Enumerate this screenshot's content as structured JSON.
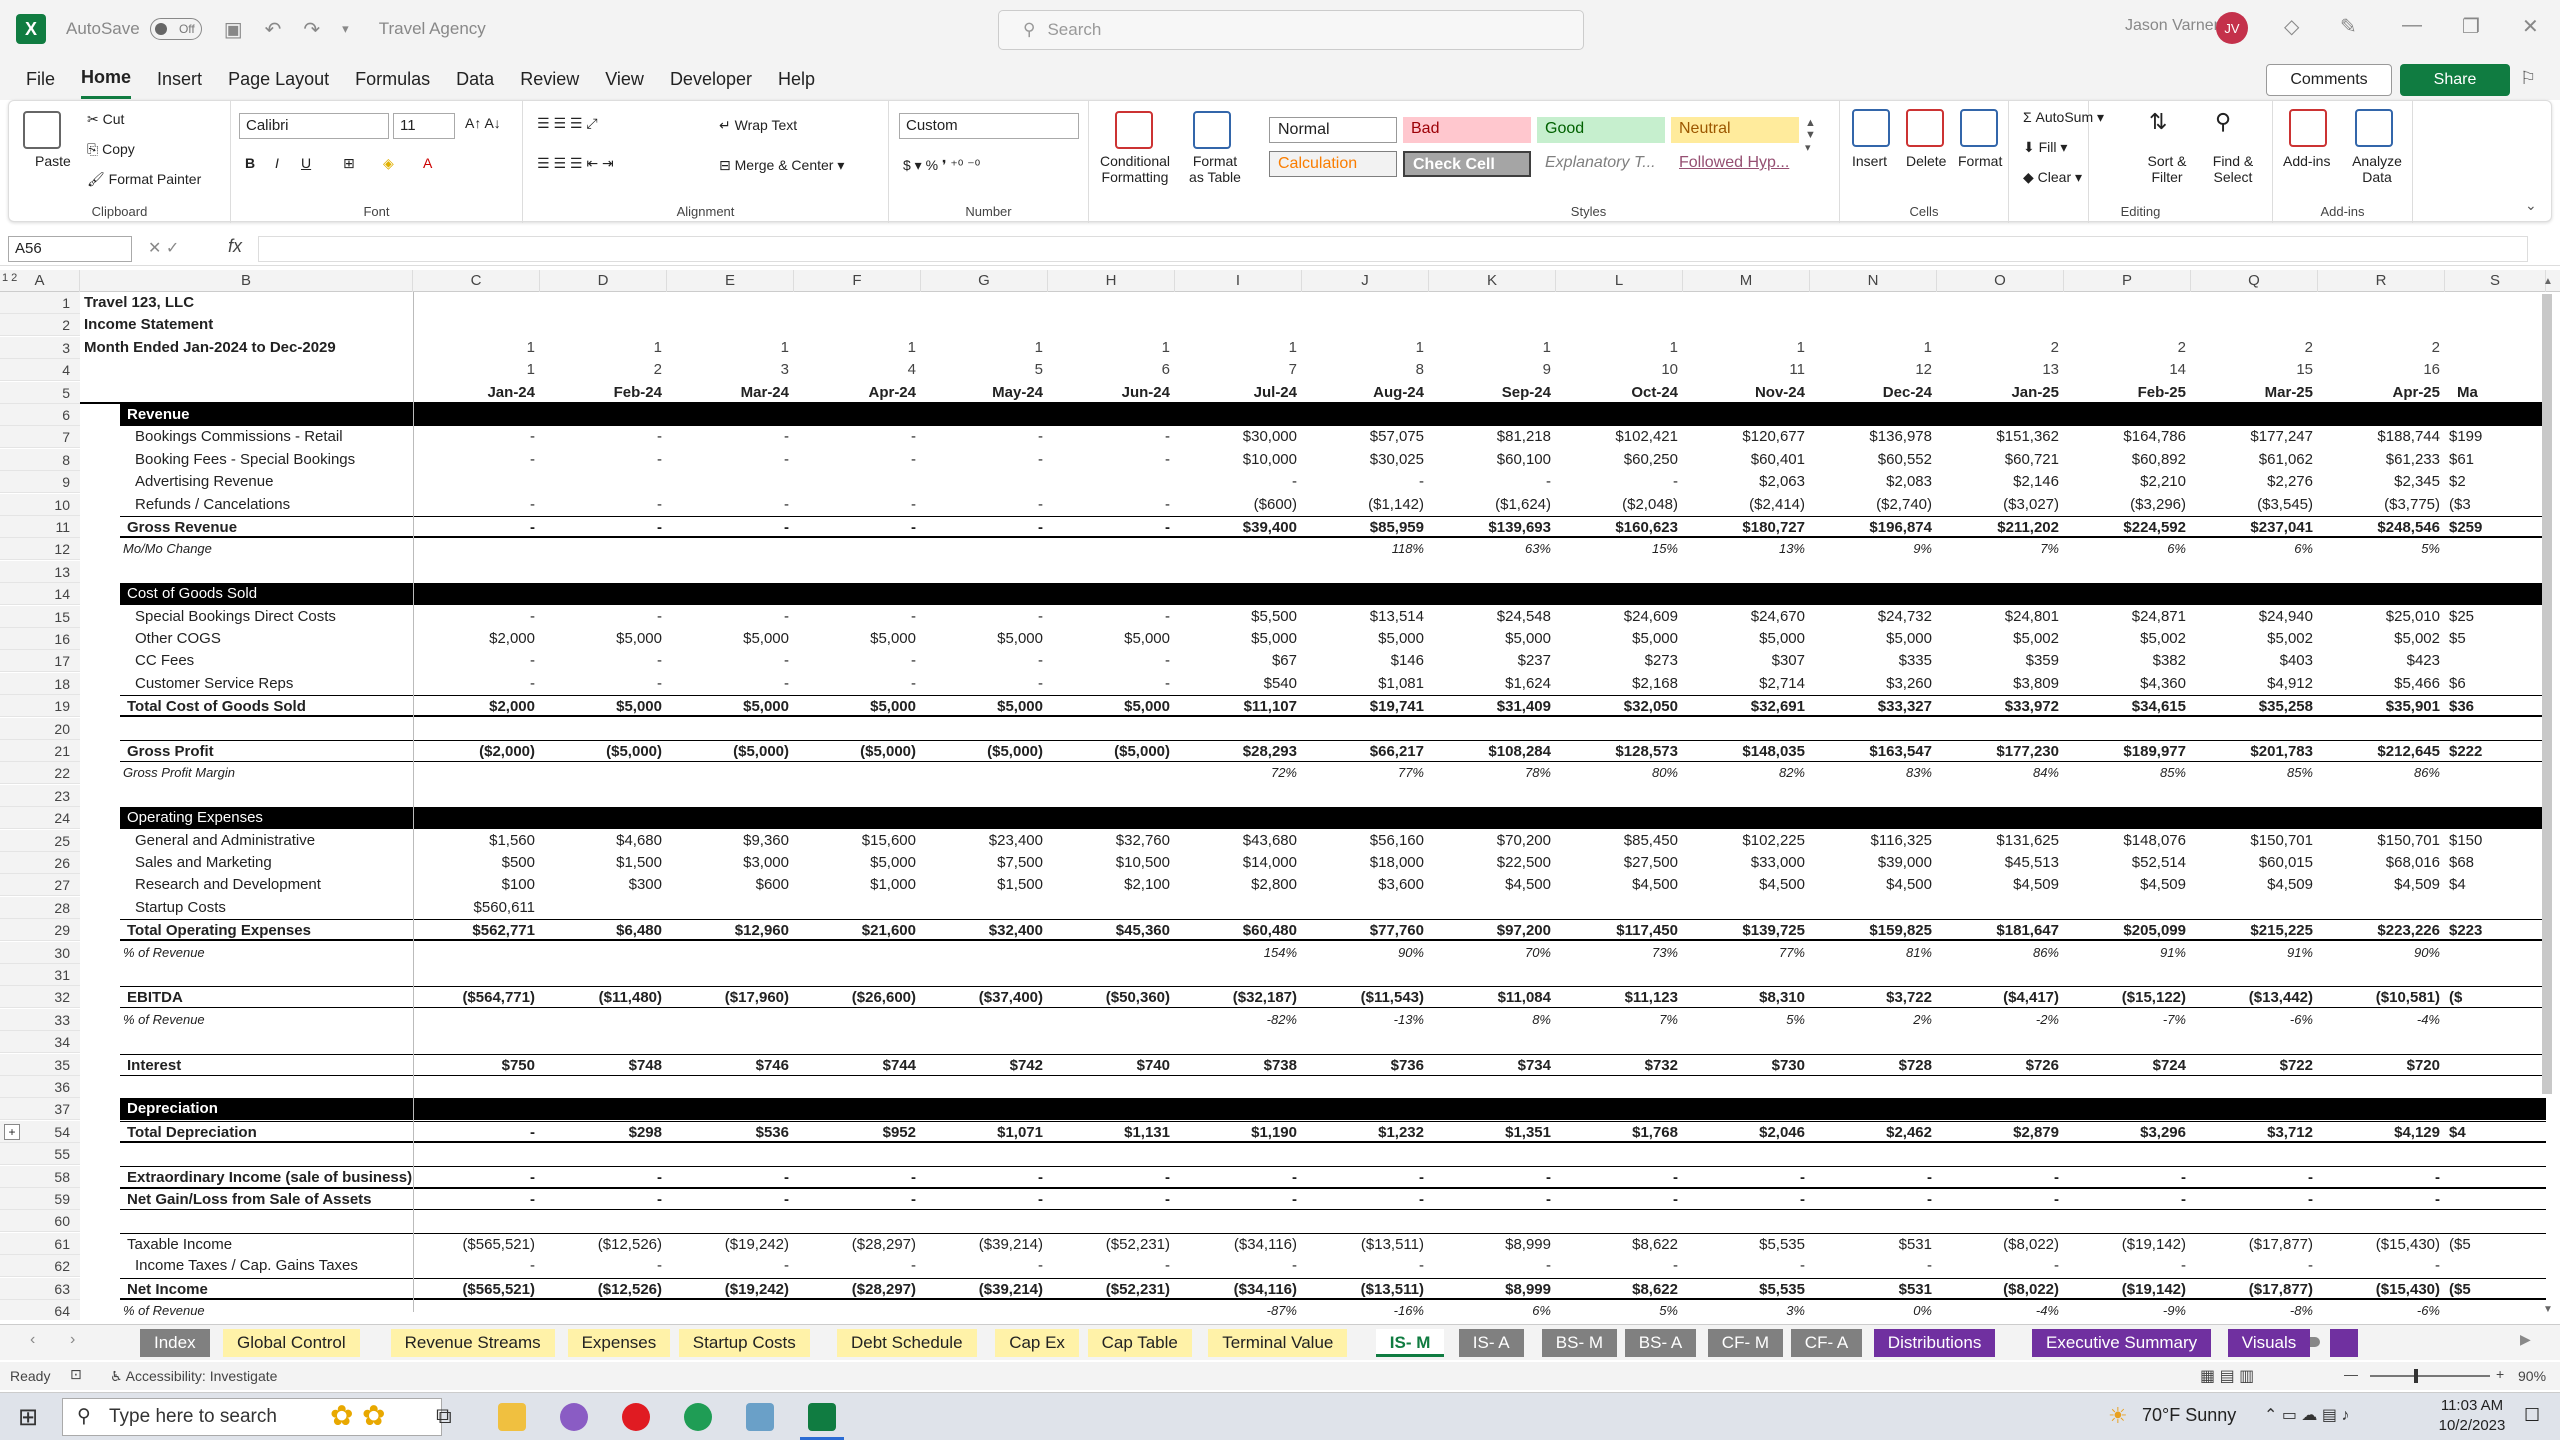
{
  "titlebar": {
    "autosave": "AutoSave",
    "toggle": "Off",
    "title": "Travel Agency",
    "search": "Search",
    "user": "Jason Varner",
    "initials": "JV"
  },
  "menu": [
    "File",
    "Home",
    "Insert",
    "Page Layout",
    "Formulas",
    "Data",
    "Review",
    "View",
    "Developer",
    "Help"
  ],
  "menu_active": "Home",
  "comments": "Comments",
  "share": "Share",
  "ribbon": {
    "clipboard": {
      "label": "Clipboard",
      "paste": "Paste",
      "cut": "Cut",
      "copy": "Copy",
      "format_painter": "Format Painter"
    },
    "font": {
      "label": "Font",
      "name": "Calibri",
      "size": "11"
    },
    "alignment": {
      "label": "Alignment",
      "wrap": "Wrap Text",
      "merge": "Merge & Center"
    },
    "number": {
      "label": "Number",
      "format": "Custom"
    },
    "styles": {
      "label": "Styles",
      "cond": "Conditional Formatting",
      "table": "Format as Table",
      "cells": [
        "Normal",
        "Bad",
        "Good",
        "Neutral",
        "Calculation",
        "Check Cell",
        "Explanatory T...",
        "Followed Hyp..."
      ]
    },
    "cells": {
      "label": "Cells",
      "insert": "Insert",
      "delete": "Delete",
      "format": "Format"
    },
    "editing": {
      "label": "Editing",
      "autosum": "AutoSum",
      "fill": "Fill",
      "clear": "Clear",
      "sort": "Sort & Filter",
      "find": "Find & Select"
    },
    "addins": {
      "label": "Add-ins",
      "addins": "Add-ins",
      "analyze": "Analyze Data"
    }
  },
  "formula": {
    "namebox": "A56",
    "fx": "fx"
  },
  "columns": [
    "A",
    "B",
    "C",
    "D",
    "E",
    "F",
    "G",
    "H",
    "I",
    "J",
    "K",
    "L",
    "M",
    "N",
    "O",
    "P",
    "Q",
    "R",
    "S"
  ],
  "header_rows": {
    "r1": "Travel 123, LLC",
    "r2": "Income Statement",
    "r3": "Month Ended Jan-2024 to Dec-2029",
    "years": [
      "1",
      "1",
      "1",
      "1",
      "1",
      "1",
      "1",
      "1",
      "1",
      "1",
      "1",
      "1",
      "2",
      "2",
      "2",
      "2"
    ],
    "months": [
      "1",
      "2",
      "3",
      "4",
      "5",
      "6",
      "7",
      "8",
      "9",
      "10",
      "11",
      "12",
      "13",
      "14",
      "15",
      "16"
    ],
    "dates": [
      "Jan-24",
      "Feb-24",
      "Mar-24",
      "Apr-24",
      "May-24",
      "Jun-24",
      "Jul-24",
      "Aug-24",
      "Sep-24",
      "Oct-24",
      "Nov-24",
      "Dec-24",
      "Jan-25",
      "Feb-25",
      "Mar-25",
      "Apr-25"
    ],
    "cut_date": "Ma"
  },
  "rows": [
    {
      "n": "1"
    },
    {
      "n": "2"
    },
    {
      "n": "3"
    },
    {
      "n": "4"
    },
    {
      "n": "5"
    },
    {
      "n": "6",
      "label": "Revenue",
      "style": "black"
    },
    {
      "n": "7",
      "label": "Bookings Commissions - Retail",
      "in": true,
      "v": [
        "-",
        "-",
        "-",
        "-",
        "-",
        "-",
        "$30,000",
        "$57,075",
        "$81,218",
        "$102,421",
        "$120,677",
        "$136,978",
        "$151,362",
        "$164,786",
        "$177,247",
        "$188,744"
      ],
      "cut": "$199"
    },
    {
      "n": "8",
      "label": "Booking Fees - Special Bookings",
      "in": true,
      "v": [
        "-",
        "-",
        "-",
        "-",
        "-",
        "-",
        "$10,000",
        "$30,025",
        "$60,100",
        "$60,250",
        "$60,401",
        "$60,552",
        "$60,721",
        "$60,892",
        "$61,062",
        "$61,233"
      ],
      "cut": "$61"
    },
    {
      "n": "9",
      "label": "Advertising Revenue",
      "in": true,
      "v": [
        "",
        "",
        "",
        "",
        "",
        "",
        "-",
        "-",
        "-",
        "-",
        "$2,063",
        "$2,083",
        "$2,146",
        "$2,210",
        "$2,276",
        "$2,345"
      ],
      "cut": "$2"
    },
    {
      "n": "10",
      "label": "Refunds / Cancelations",
      "in": true,
      "v": [
        "-",
        "-",
        "-",
        "-",
        "-",
        "-",
        "($600)",
        "($1,142)",
        "($1,624)",
        "($2,048)",
        "($2,414)",
        "($2,740)",
        "($3,027)",
        "($3,296)",
        "($3,545)",
        "($3,775)"
      ],
      "cut": "($3"
    },
    {
      "n": "11",
      "label": "Gross Revenue",
      "style": "total",
      "v": [
        "-",
        "-",
        "-",
        "-",
        "-",
        "-",
        "$39,400",
        "$85,959",
        "$139,693",
        "$160,623",
        "$180,727",
        "$196,874",
        "$211,202",
        "$224,592",
        "$237,041",
        "$248,546"
      ],
      "cut": "$259"
    },
    {
      "n": "12",
      "label": "Mo/Mo Change",
      "style": "pct",
      "v": [
        "",
        "",
        "",
        "",
        "",
        "",
        "",
        "118%",
        "63%",
        "15%",
        "13%",
        "9%",
        "7%",
        "6%",
        "6%",
        "5%"
      ]
    },
    {
      "n": "13"
    },
    {
      "n": "14",
      "label": "Cost of Goods Sold",
      "style": "blackn"
    },
    {
      "n": "15",
      "label": "Special Bookings Direct Costs",
      "in": true,
      "v": [
        "-",
        "-",
        "-",
        "-",
        "-",
        "-",
        "$5,500",
        "$13,514",
        "$24,548",
        "$24,609",
        "$24,670",
        "$24,732",
        "$24,801",
        "$24,871",
        "$24,940",
        "$25,010"
      ],
      "cut": "$25"
    },
    {
      "n": "16",
      "label": "Other COGS",
      "in": true,
      "v": [
        "$2,000",
        "$5,000",
        "$5,000",
        "$5,000",
        "$5,000",
        "$5,000",
        "$5,000",
        "$5,000",
        "$5,000",
        "$5,000",
        "$5,000",
        "$5,000",
        "$5,002",
        "$5,002",
        "$5,002",
        "$5,002"
      ],
      "cut": "$5"
    },
    {
      "n": "17",
      "label": "CC Fees",
      "in": true,
      "v": [
        "-",
        "-",
        "-",
        "-",
        "-",
        "-",
        "$67",
        "$146",
        "$237",
        "$273",
        "$307",
        "$335",
        "$359",
        "$382",
        "$403",
        "$423"
      ]
    },
    {
      "n": "18",
      "label": "Customer Service Reps",
      "in": true,
      "v": [
        "-",
        "-",
        "-",
        "-",
        "-",
        "-",
        "$540",
        "$1,081",
        "$1,624",
        "$2,168",
        "$2,714",
        "$3,260",
        "$3,809",
        "$4,360",
        "$4,912",
        "$5,466"
      ],
      "cut": "$6"
    },
    {
      "n": "19",
      "label": "Total Cost of Goods Sold",
      "style": "total",
      "v": [
        "$2,000",
        "$5,000",
        "$5,000",
        "$5,000",
        "$5,000",
        "$5,000",
        "$11,107",
        "$19,741",
        "$31,409",
        "$32,050",
        "$32,691",
        "$33,327",
        "$33,972",
        "$34,615",
        "$35,258",
        "$35,901"
      ],
      "cut": "$36"
    },
    {
      "n": "20"
    },
    {
      "n": "21",
      "label": "Gross Profit",
      "style": "boxed",
      "v": [
        "($2,000)",
        "($5,000)",
        "($5,000)",
        "($5,000)",
        "($5,000)",
        "($5,000)",
        "$28,293",
        "$66,217",
        "$108,284",
        "$128,573",
        "$148,035",
        "$163,547",
        "$177,230",
        "$189,977",
        "$201,783",
        "$212,645"
      ],
      "cut": "$222"
    },
    {
      "n": "22",
      "label": "Gross Profit Margin",
      "style": "pct",
      "v": [
        "",
        "",
        "",
        "",
        "",
        "",
        "72%",
        "77%",
        "78%",
        "80%",
        "82%",
        "83%",
        "84%",
        "85%",
        "85%",
        "86%"
      ]
    },
    {
      "n": "23"
    },
    {
      "n": "24",
      "label": "Operating Expenses",
      "style": "blackn"
    },
    {
      "n": "25",
      "label": "General and Administrative",
      "in": true,
      "v": [
        "$1,560",
        "$4,680",
        "$9,360",
        "$15,600",
        "$23,400",
        "$32,760",
        "$43,680",
        "$56,160",
        "$70,200",
        "$85,450",
        "$102,225",
        "$116,325",
        "$131,625",
        "$148,076",
        "$150,701",
        "$150,701"
      ],
      "cut": "$150"
    },
    {
      "n": "26",
      "label": "Sales and Marketing",
      "in": true,
      "v": [
        "$500",
        "$1,500",
        "$3,000",
        "$5,000",
        "$7,500",
        "$10,500",
        "$14,000",
        "$18,000",
        "$22,500",
        "$27,500",
        "$33,000",
        "$39,000",
        "$45,513",
        "$52,514",
        "$60,015",
        "$68,016"
      ],
      "cut": "$68"
    },
    {
      "n": "27",
      "label": "Research and Development",
      "in": true,
      "v": [
        "$100",
        "$300",
        "$600",
        "$1,000",
        "$1,500",
        "$2,100",
        "$2,800",
        "$3,600",
        "$4,500",
        "$4,500",
        "$4,500",
        "$4,500",
        "$4,509",
        "$4,509",
        "$4,509",
        "$4,509"
      ],
      "cut": "$4"
    },
    {
      "n": "28",
      "label": "Startup Costs",
      "in": true,
      "v": [
        "$560,611",
        "",
        "",
        "",
        "",
        "",
        "",
        "",
        "",
        "",
        "",
        "",
        "",
        "",
        "",
        ""
      ]
    },
    {
      "n": "29",
      "label": "Total Operating Expenses",
      "style": "total",
      "v": [
        "$562,771",
        "$6,480",
        "$12,960",
        "$21,600",
        "$32,400",
        "$45,360",
        "$60,480",
        "$77,760",
        "$97,200",
        "$117,450",
        "$139,725",
        "$159,825",
        "$181,647",
        "$205,099",
        "$215,225",
        "$223,226"
      ],
      "cut": "$223"
    },
    {
      "n": "30",
      "label": "% of Revenue",
      "style": "pct",
      "v": [
        "",
        "",
        "",
        "",
        "",
        "",
        "154%",
        "90%",
        "70%",
        "73%",
        "77%",
        "81%",
        "86%",
        "91%",
        "91%",
        "90%"
      ]
    },
    {
      "n": "31"
    },
    {
      "n": "32",
      "label": "EBITDA",
      "style": "boxed",
      "v": [
        "($564,771)",
        "($11,480)",
        "($17,960)",
        "($26,600)",
        "($37,400)",
        "($50,360)",
        "($32,187)",
        "($11,543)",
        "$11,084",
        "$11,123",
        "$8,310",
        "$3,722",
        "($4,417)",
        "($15,122)",
        "($13,442)",
        "($10,581)"
      ],
      "cut": "($"
    },
    {
      "n": "33",
      "label": "% of Revenue",
      "style": "pct",
      "v": [
        "",
        "",
        "",
        "",
        "",
        "",
        "-82%",
        "-13%",
        "8%",
        "7%",
        "5%",
        "2%",
        "-2%",
        "-7%",
        "-6%",
        "-4%"
      ]
    },
    {
      "n": "34"
    },
    {
      "n": "35",
      "label": "Interest",
      "style": "boxed",
      "v": [
        "$750",
        "$748",
        "$746",
        "$744",
        "$742",
        "$740",
        "$738",
        "$736",
        "$734",
        "$732",
        "$730",
        "$728",
        "$726",
        "$724",
        "$722",
        "$720"
      ]
    },
    {
      "n": "36"
    },
    {
      "n": "37",
      "label": "Depreciation",
      "style": "black"
    },
    {
      "n": "54",
      "label": "Total Depreciation",
      "style": "totalb",
      "v": [
        "-",
        "$298",
        "$536",
        "$952",
        "$1,071",
        "$1,131",
        "$1,190",
        "$1,232",
        "$1,351",
        "$1,768",
        "$2,046",
        "$2,462",
        "$2,879",
        "$3,296",
        "$3,712",
        "$4,129"
      ],
      "cut": "$4"
    },
    {
      "n": "55"
    },
    {
      "n": "58",
      "label": "Extraordinary Income (sale of business)",
      "style": "boxed",
      "v": [
        "-",
        "-",
        "-",
        "-",
        "-",
        "-",
        "-",
        "-",
        "-",
        "-",
        "-",
        "-",
        "-",
        "-",
        "-",
        "-"
      ]
    },
    {
      "n": "59",
      "label": "Net Gain/Loss from Sale of Assets",
      "style": "boxed",
      "v": [
        "-",
        "-",
        "-",
        "-",
        "-",
        "-",
        "-",
        "-",
        "-",
        "-",
        "-",
        "-",
        "-",
        "-",
        "-",
        "-"
      ]
    },
    {
      "n": "60"
    },
    {
      "n": "61",
      "label": "Taxable Income",
      "style": "topline",
      "v": [
        "($565,521)",
        "($12,526)",
        "($19,242)",
        "($28,297)",
        "($39,214)",
        "($52,231)",
        "($34,116)",
        "($13,511)",
        "$8,999",
        "$8,622",
        "$5,535",
        "$531",
        "($8,022)",
        "($19,142)",
        "($17,877)",
        "($15,430)"
      ],
      "cut": "($5"
    },
    {
      "n": "62",
      "label": "Income Taxes / Cap. Gains Taxes",
      "in": true,
      "v": [
        "-",
        "-",
        "-",
        "-",
        "-",
        "-",
        "-",
        "-",
        "-",
        "-",
        "-",
        "-",
        "-",
        "-",
        "-",
        "-"
      ]
    },
    {
      "n": "63",
      "label": "Net Income",
      "style": "net",
      "v": [
        "($565,521)",
        "($12,526)",
        "($19,242)",
        "($28,297)",
        "($39,214)",
        "($52,231)",
        "($34,116)",
        "($13,511)",
        "$8,999",
        "$8,622",
        "$5,535",
        "$531",
        "($8,022)",
        "($19,142)",
        "($17,877)",
        "($15,430)"
      ],
      "cut": "($5"
    },
    {
      "n": "64",
      "label": "% of Revenue",
      "style": "pct",
      "v": [
        "",
        "",
        "",
        "",
        "",
        "",
        "-87%",
        "-16%",
        "6%",
        "5%",
        "3%",
        "0%",
        "-4%",
        "-9%",
        "-8%",
        "-6%"
      ]
    }
  ],
  "sheets": [
    {
      "name": "Index",
      "bg": "#808080",
      "fg": "#ffffff"
    },
    {
      "name": "Global Control",
      "bg": "#fff2a8",
      "fg": "#222222"
    },
    {
      "name": "Revenue Streams",
      "bg": "#fff2a8",
      "fg": "#222222"
    },
    {
      "name": "Expenses",
      "bg": "#fff2a8",
      "fg": "#222222"
    },
    {
      "name": "Startup Costs",
      "bg": "#fff2a8",
      "fg": "#222222"
    },
    {
      "name": "Debt Schedule",
      "bg": "#fff2a8",
      "fg": "#222222"
    },
    {
      "name": "Cap Ex",
      "bg": "#fff2a8",
      "fg": "#222222"
    },
    {
      "name": "Cap Table",
      "bg": "#fff2a8",
      "fg": "#222222"
    },
    {
      "name": "Terminal Value",
      "bg": "#fff2a8",
      "fg": "#222222"
    },
    {
      "name": "IS- M",
      "bg": "#ffffff",
      "fg": "#222222",
      "active": true
    },
    {
      "name": "IS- A",
      "bg": "#808080",
      "fg": "#ffffff"
    },
    {
      "name": "BS- M",
      "bg": "#808080",
      "fg": "#ffffff"
    },
    {
      "name": "BS- A",
      "bg": "#808080",
      "fg": "#ffffff"
    },
    {
      "name": "CF- M",
      "bg": "#808080",
      "fg": "#ffffff"
    },
    {
      "name": "CF- A",
      "bg": "#808080",
      "fg": "#ffffff"
    },
    {
      "name": "Distributions",
      "bg": "#7030a0",
      "fg": "#ffffff"
    },
    {
      "name": "Executive Summary",
      "bg": "#7030a0",
      "fg": "#ffffff"
    },
    {
      "name": "Visuals",
      "bg": "#7030a0",
      "fg": "#ffffff"
    }
  ],
  "status": {
    "ready": "Ready",
    "accessibility": "Accessibility: Investigate",
    "zoom": "90%"
  },
  "taskbar": {
    "search": "Type here to search",
    "weather": "70°F  Sunny",
    "time": "11:03 AM",
    "date": "10/2/2023"
  }
}
